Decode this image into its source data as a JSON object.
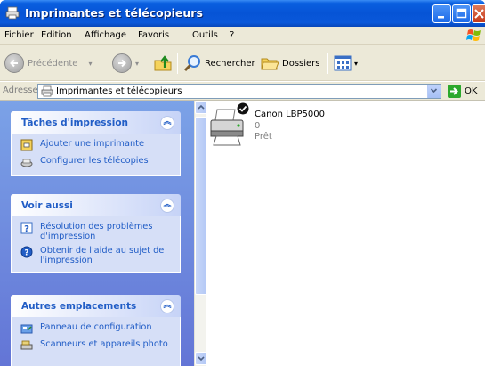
{
  "window": {
    "title": "Imprimantes et télécopieurs"
  },
  "menu": [
    "Fichier",
    "Edition",
    "Affichage",
    "Favoris",
    "Outils",
    "?"
  ],
  "toolbar": {
    "back_label": "Précédente",
    "search_label": "Rechercher",
    "folders_label": "Dossiers"
  },
  "address": {
    "label": "Adresse",
    "value": "Imprimantes et télécopieurs",
    "go_label": "OK"
  },
  "sidebar": {
    "panels": [
      {
        "title": "Tâches d'impression",
        "items": [
          {
            "label": "Ajouter une imprimante",
            "icon": "add-printer-icon"
          },
          {
            "label": "Configurer les télécopies",
            "icon": "fax-icon"
          }
        ]
      },
      {
        "title": "Voir aussi",
        "items": [
          {
            "label": "Résolution des problèmes d'impression",
            "icon": "help-book-icon"
          },
          {
            "label": "Obtenir de l'aide au sujet de l'impression",
            "icon": "help-circle-icon"
          }
        ]
      },
      {
        "title": "Autres emplacements",
        "items": [
          {
            "label": "Panneau de configuration",
            "icon": "control-panel-icon"
          },
          {
            "label": "Scanneurs et appareils photo",
            "icon": "scanner-icon"
          }
        ]
      }
    ]
  },
  "printers": [
    {
      "name": "Canon LBP5000",
      "documents": "0",
      "status": "Prêt",
      "icon": "printer-icon",
      "default": true
    }
  ]
}
